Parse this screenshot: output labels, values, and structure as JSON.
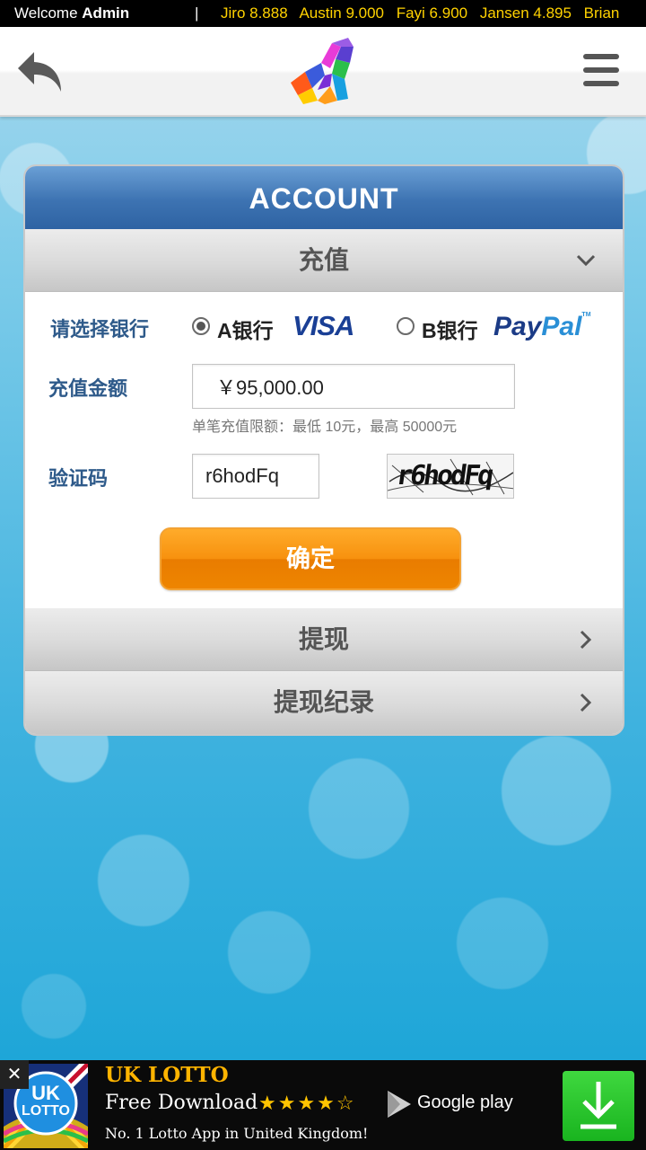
{
  "topbar": {
    "welcome_prefix": "Welcome",
    "welcome_user": "Admin",
    "separator": "|",
    "ticker": [
      "Jiro 8.888",
      "Austin 9.000",
      "Fayi 6.900",
      "Jansen 4.895",
      "Brian"
    ]
  },
  "header": {
    "back_icon": "back-arrow-icon",
    "logo_icon": "colorful-logo",
    "menu_icon": "hamburger-menu-icon"
  },
  "account": {
    "title": "ACCOUNT",
    "deposit_section": "充值",
    "bank_label": "请选择银行",
    "bank_a": "A银行",
    "bank_a_brand": "VISA",
    "bank_b": "B银行",
    "bank_b_brand_1": "Pay",
    "bank_b_brand_2": "Pal",
    "bank_b_brand_tm": "TM",
    "selected_bank": "A银行",
    "amount_label": "充值金额",
    "amount_value": "￥95,000.00",
    "amount_hint": "单笔充值限额：最低 10元，最高 50000元",
    "captcha_label": "验证码",
    "captcha_value": "r6hodFq",
    "captcha_image_text": "r6hodFq",
    "confirm_button": "确定",
    "withdraw_section": "提现",
    "withdraw_history_section": "提现纪录"
  },
  "ad": {
    "close": "✕",
    "logo_line1": "UK",
    "logo_line2": "LOTTO",
    "title": "UK LOTTO",
    "subtitle": "Free Download",
    "stars": "★★★★☆",
    "store": "Google play",
    "description": "No. 1 Lotto App in United Kingdom!",
    "download_icon": "download-icon"
  },
  "colors": {
    "header_blue": "#3d73b2",
    "label_blue": "#2e5a8a",
    "confirm_orange": "#f7910e",
    "ticker_yellow": "#ffd200"
  }
}
